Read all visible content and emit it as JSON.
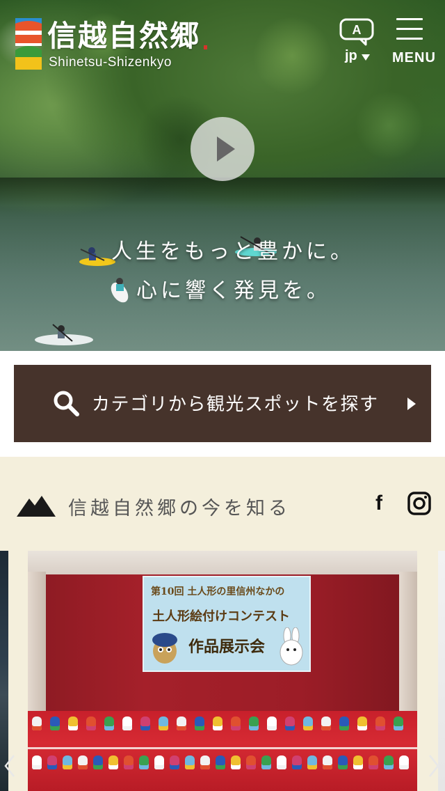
{
  "header": {
    "logo_title": "信越自然郷",
    "logo_subtitle": "Shinetsu-Shizenkyo",
    "lang_icon_letter": "A",
    "lang_label": "jp",
    "menu_label": "MENU"
  },
  "hero": {
    "copy_line1": "人生をもっと豊かに。",
    "copy_line2": "心に響く発見を。"
  },
  "search": {
    "label": "カテゴリから観光スポットを探す"
  },
  "news": {
    "heading": "信越自然郷の今を知る",
    "facebook_glyph": "f",
    "slide": {
      "poster_line1": "第10回 土人形の里信州なかの",
      "poster_line2": "土人形絵付けコンテスト",
      "poster_line3": "作品展示会"
    }
  },
  "colors": {
    "search_bg": "#46332b",
    "news_bg": "#f4efdc",
    "logo_orange": "#e8542b",
    "logo_green": "#3a9a3a",
    "logo_yellow": "#f2c21a",
    "logo_blue": "#2a8ed0"
  },
  "icons": [
    "logo-mark",
    "speech-bubble-icon",
    "menu-icon",
    "play-icon",
    "search-icon",
    "chevron-right-icon",
    "mountain-icon",
    "facebook-icon",
    "instagram-icon",
    "chevron-left-icon"
  ]
}
